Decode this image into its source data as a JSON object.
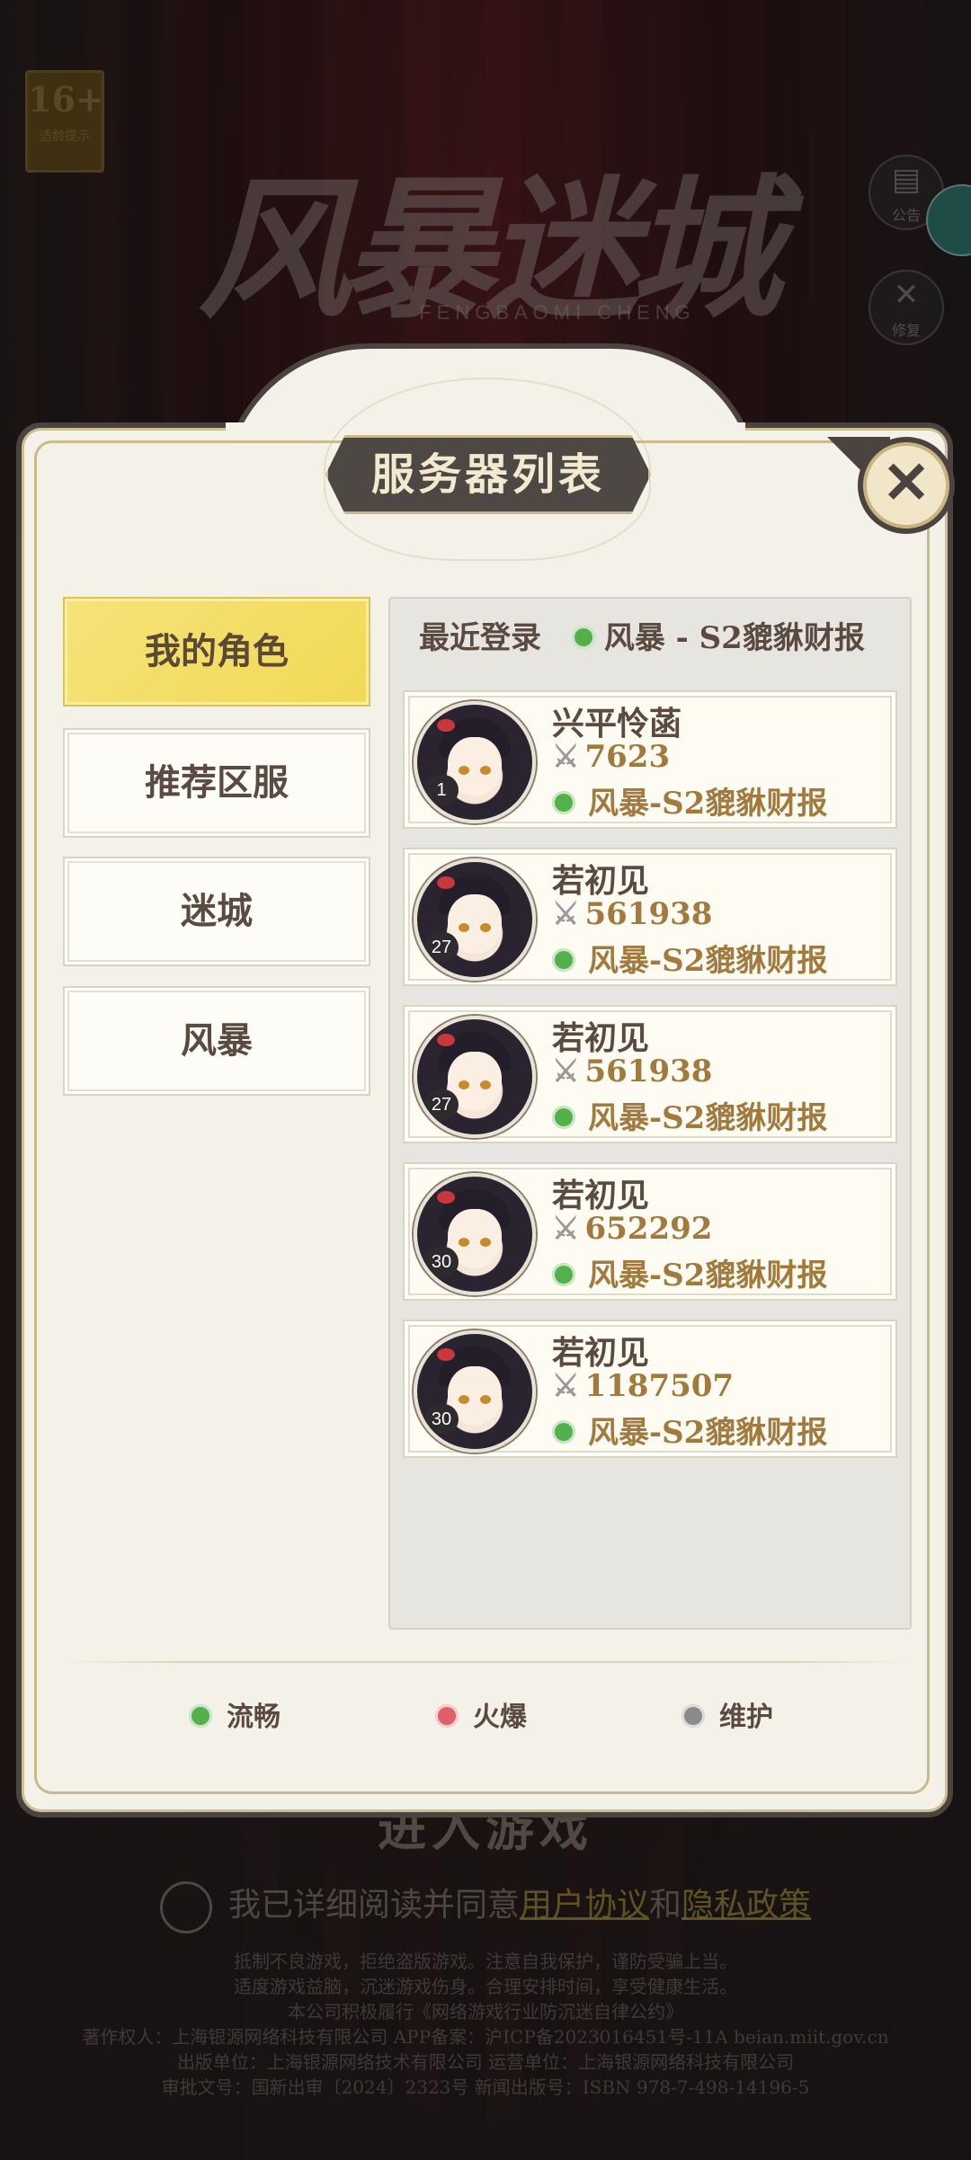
{
  "background": {
    "age_badge": {
      "number": "16+",
      "label": "适龄提示"
    },
    "logo_title": "风暴迷城",
    "logo_subtitle": "FENGBAOMI CHENG",
    "side_buttons": [
      {
        "icon": "notice-icon",
        "label": "公告"
      },
      {
        "icon": "wrench-icon",
        "label": "修复"
      }
    ],
    "enter_button": "进入游戏",
    "agreement": {
      "prefix": "我已详细阅读并同意",
      "user_agreement": "用户协议",
      "and": "和",
      "privacy_policy": "隐私政策"
    },
    "health_notice": [
      "抵制不良游戏，拒绝盗版游戏。注意自我保护，谨防受骗上当。",
      "适度游戏益脑，沉迷游戏伤身。合理安排时间，享受健康生活。",
      "本公司积极履行《网络游戏行业防沉迷自律公约》"
    ],
    "footer_info": [
      "著作权人：上海银源网络科技有限公司 APP备案：沪ICP备2023016451号-11A beian.miit.gov.cn",
      "出版单位：上海银源网络技术有限公司 运营单位：上海银源网络科技有限公司",
      "审批文号：国新出审〔2024〕2323号 新闻出版号：ISBN 978-7-498-14196-5"
    ]
  },
  "dialog": {
    "title": "服务器列表",
    "close_icon": "close-icon",
    "tabs": [
      {
        "label": "我的角色",
        "active": true
      },
      {
        "label": "推荐区服",
        "active": false
      },
      {
        "label": "迷城",
        "active": false
      },
      {
        "label": "风暴",
        "active": false
      }
    ],
    "recent_login_label": "最近登录",
    "recent_server": "风暴 - S2貔貅财报",
    "characters": [
      {
        "name": "兴平怜菡",
        "level": "1",
        "power": "7623",
        "server": "风暴-S2貔貅财报"
      },
      {
        "name": "若初见",
        "level": "27",
        "power": "561938",
        "server": "风暴-S2貔貅财报"
      },
      {
        "name": "若初见",
        "level": "27",
        "power": "561938",
        "server": "风暴-S2貔貅财报"
      },
      {
        "name": "若初见",
        "level": "30",
        "power": "652292",
        "server": "风暴-S2貔貅财报"
      },
      {
        "name": "若初见",
        "level": "30",
        "power": "1187507",
        "server": "风暴-S2貔貅财报"
      }
    ],
    "legend": [
      {
        "label": "流畅",
        "color": "#53b04a"
      },
      {
        "label": "火爆",
        "color": "#e0606a"
      },
      {
        "label": "维护",
        "color": "#8b8b8b"
      }
    ]
  }
}
